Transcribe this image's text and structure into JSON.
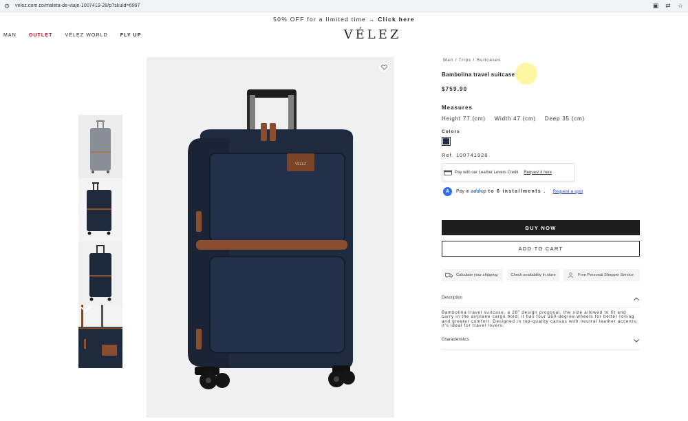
{
  "browser": {
    "url": "velez.com.co/maleta-de-viaje-1007419-28/p?skuId=6997"
  },
  "promo": {
    "text": "50% OFF for a limited time →",
    "link": "Click here"
  },
  "nav": {
    "items": [
      "MAN",
      "OUTLET",
      "VÉLEZ WORLD",
      "FLY UP"
    ]
  },
  "logo": "VÉLEZ",
  "breadcrumb": "Man / Trips / Suitcases",
  "product": {
    "name": "Bambolina travel suitcase",
    "price": "$759.90",
    "measures_heading": "Measures",
    "measures": [
      "Height 77 (cm)",
      "Width 47 (cm)",
      "Deep 35 (cm)"
    ],
    "colors_heading": "Colors",
    "color_hex": "#1e2b44",
    "ref": "Ref. 100741928"
  },
  "credit": {
    "text": "Pay with our Leather Lovers Credit",
    "link": "Request it here"
  },
  "addi": {
    "logo": "A",
    "pay_in": "Pay in",
    "brand": "addi",
    "up_to": "up",
    "installments": "to 6 installments .",
    "link": "Request a spot"
  },
  "actions": {
    "buy_now": "BUY NOW",
    "add_to_cart": "ADD TO CART"
  },
  "services": {
    "shipping": "Calculate your shipping",
    "availability": "Check availability in store",
    "shopper": "Free Personal Shopper Service"
  },
  "description": {
    "heading": "Description",
    "text": "Bambolina travel suitcase, a 28\" design proposal, the size allowed to fit and carry in the airplane cargo hold; it has four 360-degree wheels for better rolling and greater comfort. Designed in top-quality canvas with neutral leather accents, it's ideal for travel lovers."
  },
  "characteristics": {
    "heading": "Characteristics"
  }
}
